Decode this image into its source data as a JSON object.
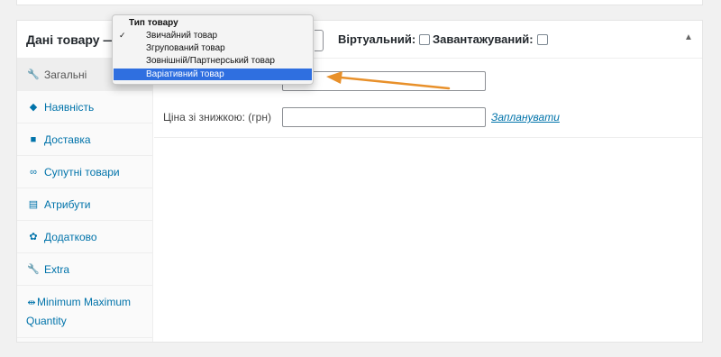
{
  "panel": {
    "title": "Дані товару —",
    "virtual_label": "Віртуальний:",
    "downloadable_label": "Завантажуваний:",
    "collapse_icon": "triangle-up-icon"
  },
  "product_type_dropdown": {
    "group_label": "Тип товару",
    "options": [
      "Звичайний товар",
      "Згрупований товар",
      "Зовнішній/Партнерський товар",
      "Варіативний товар"
    ],
    "checked_index": 0,
    "highlighted_index": 3,
    "highlight_color": "#2f6fe0"
  },
  "tabs": [
    {
      "label": "Загальні",
      "icon": "wrench-icon"
    },
    {
      "label": "Наявність",
      "icon": "tag-icon"
    },
    {
      "label": "Доставка",
      "icon": "truck-icon"
    },
    {
      "label": "Супутні товари",
      "icon": "link-icon"
    },
    {
      "label": "Атрибути",
      "icon": "list-icon"
    },
    {
      "label": "Додатково",
      "icon": "gear-icon"
    },
    {
      "label": "Extra",
      "icon": "wrench-icon"
    },
    {
      "label": "Minimum Maximum Quantity",
      "icon": "arrows-icon"
    }
  ],
  "general": {
    "sale_price_label": "Ціна зі знижкою: (грн)",
    "sale_price_value": "",
    "schedule_link": "Запланувати"
  },
  "annotation": {
    "arrow_color": "#e8902a"
  }
}
